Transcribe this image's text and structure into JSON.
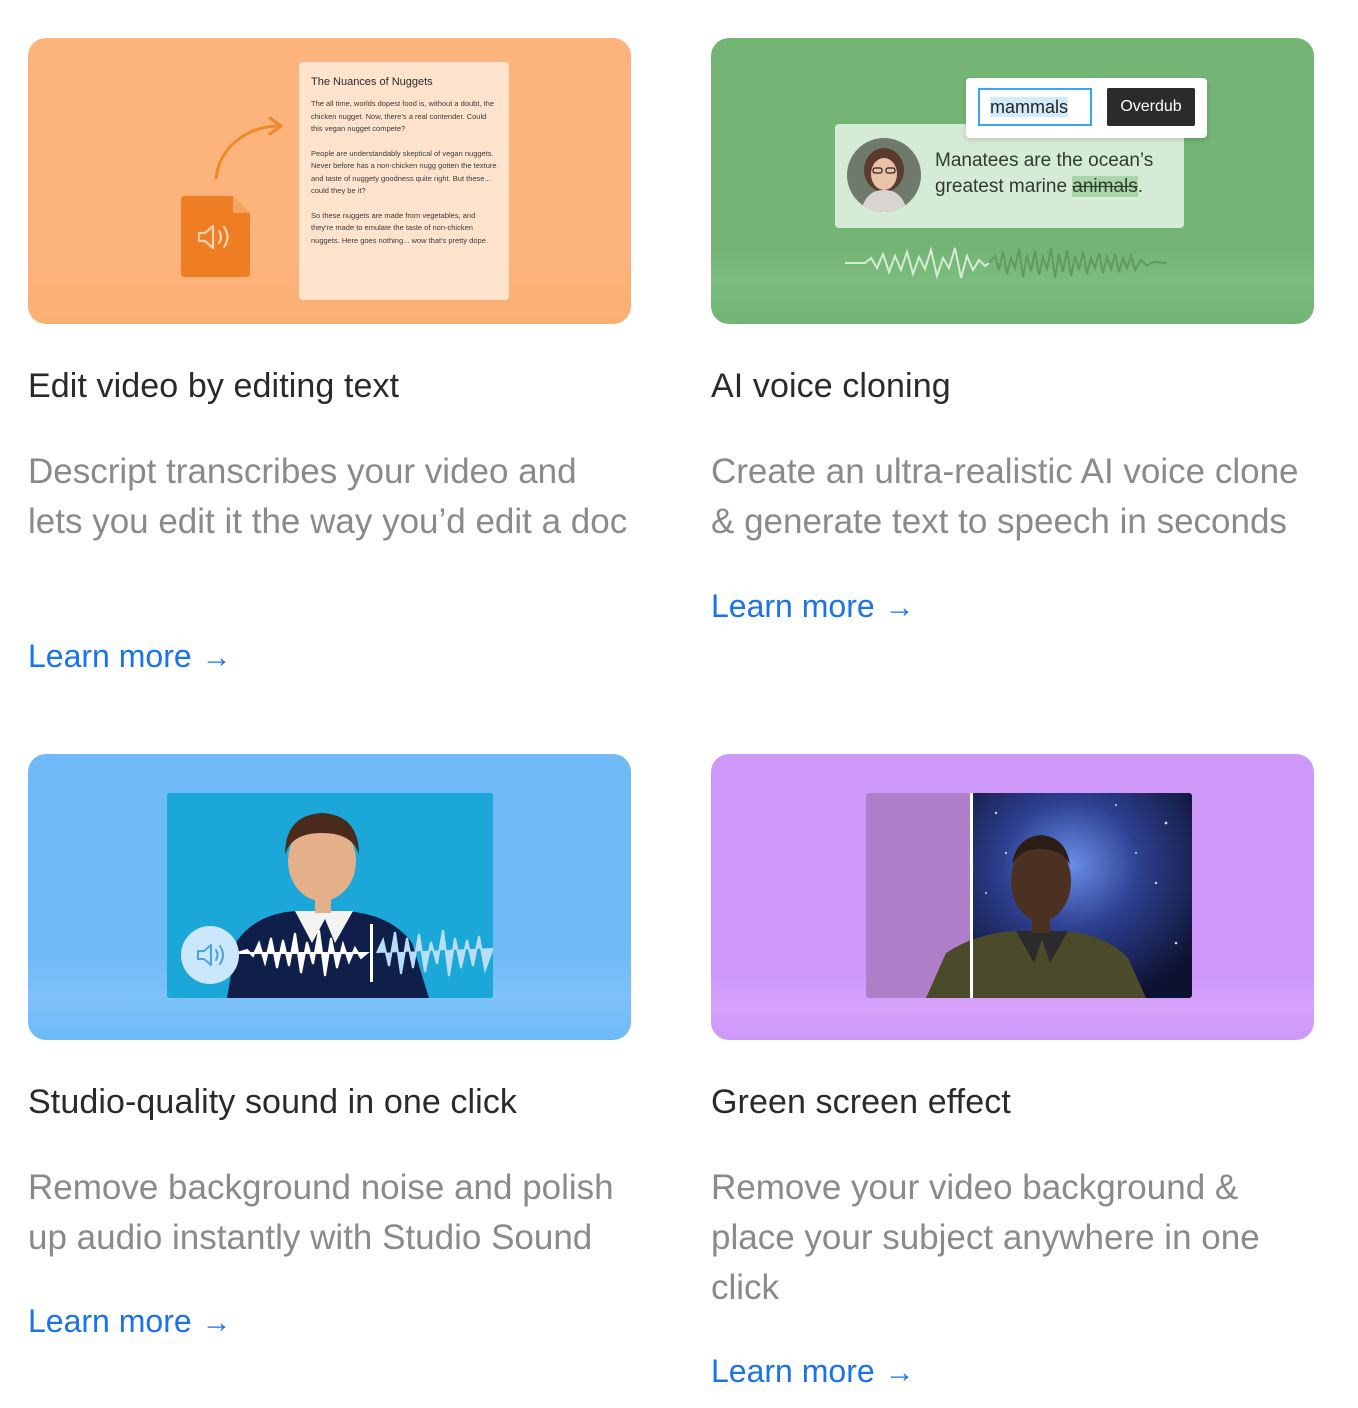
{
  "colors": {
    "link": "#1a73e8",
    "orange": "#fcb37c",
    "green": "#74b576",
    "blue": "#6fbaf7",
    "purple": "#cd98f8"
  },
  "cards": [
    {
      "title": "Edit video by editing text",
      "description": "Descript transcribes your video and lets you edit it the way you’d edit a doc",
      "link": "Learn more",
      "arrow": "→",
      "media": {
        "doc_title": "The Nuances of Nuggets",
        "doc_paragraphs": [
          "The all time, worlds dopest food is, without a doubt, the  chicken nugget. Now, there's a real contender. Could this vegan nugget compete?",
          "People are understandably skeptical of vegan nuggets. Never before has a non-chicken nugg gotten the texture and taste of nuggety goodness  quite right. But these... could they be it?",
          "So these nuggets are made from vegetables, and they're made to emulate the taste of non-chicken nuggets. Here goes nothing... wow that's pretty dope."
        ],
        "icons": [
          "curved-arrow-icon",
          "audio-file-icon",
          "speaker-icon"
        ]
      }
    },
    {
      "title": "AI voice cloning",
      "description": "Create an ultra-realistic AI voice clone & generate text to speech in seconds",
      "link": "Learn more",
      "arrow": "→",
      "media": {
        "input_value": "mammals",
        "button_label": "Overdub",
        "quote_line1": "Manatees are the ocean’s",
        "quote_line2_prefix": "greatest marine ",
        "quote_struck": "animals",
        "quote_end": ".",
        "icons": [
          "avatar",
          "waveform-icon"
        ]
      }
    },
    {
      "title": "Studio-quality sound in one click",
      "description": "Remove background noise and polish up audio instantly with Studio Sound",
      "link": "Learn more",
      "arrow": "→",
      "media": {
        "icons": [
          "speaker-icon",
          "waveform-icon"
        ]
      }
    },
    {
      "title": "Green screen effect",
      "description": "Remove your video background & place your subject anywhere in one click",
      "link": "Learn more",
      "arrow": "→",
      "media": {
        "icons": [
          "galaxy-background",
          "split-divider"
        ]
      }
    }
  ]
}
